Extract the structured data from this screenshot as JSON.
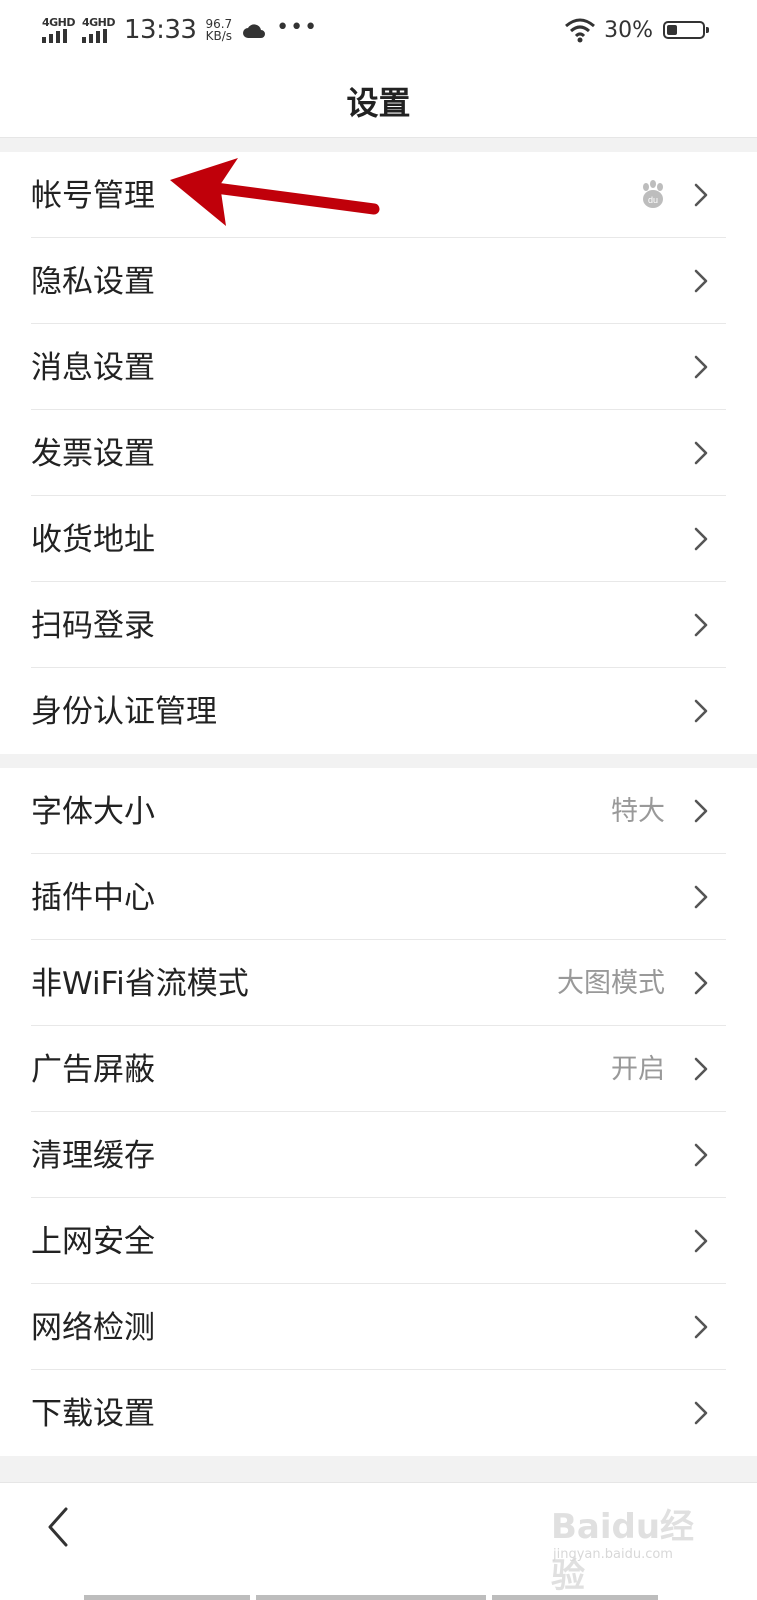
{
  "status_bar": {
    "signal1": "4GHD",
    "signal2": "4GHD",
    "time": "13:33",
    "speed_value": "96.7",
    "speed_unit": "KB/s",
    "more": "•••",
    "battery_text": "30%",
    "battery_level": 0.3
  },
  "header": {
    "title": "设置"
  },
  "group1": [
    {
      "label": "帐号管理",
      "value": ""
    },
    {
      "label": "隐私设置",
      "value": ""
    },
    {
      "label": "消息设置",
      "value": ""
    },
    {
      "label": "发票设置",
      "value": ""
    },
    {
      "label": "收货地址",
      "value": ""
    },
    {
      "label": "扫码登录",
      "value": ""
    },
    {
      "label": "身份认证管理",
      "value": ""
    }
  ],
  "group2": [
    {
      "label": "字体大小",
      "value": "特大"
    },
    {
      "label": "插件中心",
      "value": ""
    },
    {
      "label": "非WiFi省流模式",
      "value": "大图模式"
    },
    {
      "label": "广告屏蔽",
      "value": "开启"
    },
    {
      "label": "清理缓存",
      "value": ""
    },
    {
      "label": "上网安全",
      "value": ""
    },
    {
      "label": "网络检测",
      "value": ""
    },
    {
      "label": "下载设置",
      "value": ""
    }
  ],
  "watermark": {
    "main": "Baidu经验",
    "sub": "jingyan.baidu.com"
  },
  "colors": {
    "background": "#f2f2f2",
    "row_bg": "#ffffff",
    "text": "#222222",
    "secondary_text": "#999999",
    "annotation_arrow": "#c0000a"
  }
}
